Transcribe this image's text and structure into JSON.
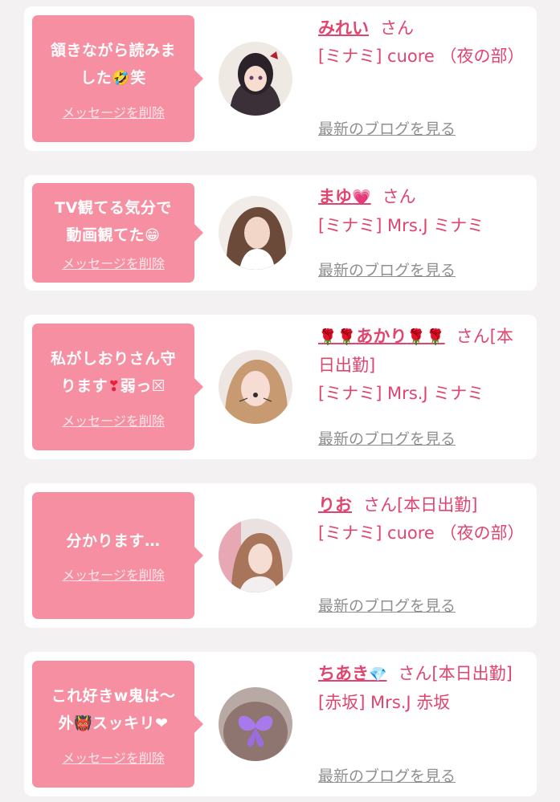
{
  "theme": {
    "bubble": "#f78fa2",
    "accent": "#e0456f",
    "muted": "#8f8f8f",
    "background": "#f3f1f2"
  },
  "cards": [
    {
      "message_line1": "頷きながら読みま",
      "message_line2_text": "した",
      "message_line2_emoji": "🤣",
      "message_line2_suffix": "笑",
      "delete_label": "メッセージを削除",
      "name": "みれい",
      "honorific": "さん",
      "shop": "[ミナミ] cuore （夜の部）",
      "blog_label": "最新のブログを見る"
    },
    {
      "message_line1": "TV観てる気分で",
      "message_line2_text": "動画観てた",
      "message_line2_emoji": "😁",
      "delete_label": "メッセージを削除",
      "name": "まゆ",
      "name_emoji": "💗",
      "honorific": "さん",
      "shop": "[ミナミ] Mrs.J ミナミ",
      "blog_label": "最新のブログを見る"
    },
    {
      "message_line1": "私がしおりさん守",
      "message_line2_text": "ります",
      "message_line2_emoji": "❣",
      "message_line2_suffix": "弱っ☒",
      "delete_label": "メッセージを削除",
      "name_prefix": "🌹🌹",
      "name": "あかり",
      "name_suffix": "🌹🌹",
      "honorific": "さん[本日出勤]",
      "shop": "[ミナミ] Mrs.J ミナミ",
      "blog_label": "最新のブログを見る"
    },
    {
      "message_line1": "分かります…",
      "delete_label": "メッセージを削除",
      "name": "りお",
      "honorific": "さん[本日出勤]",
      "shop": "[ミナミ] cuore （夜の部）",
      "blog_label": "最新のブログを見る"
    },
    {
      "message_line1": "これ好きw鬼は〜",
      "message_line2_text": "外",
      "message_line2_emoji": "👹",
      "message_line2_suffix": "スッキリ❤",
      "delete_label": "メッセージを削除",
      "name": "ちあき",
      "name_emoji": "💎",
      "honorific": "さん[本日出勤]",
      "shop": "[赤坂] Mrs.J 赤坂",
      "blog_label": "最新のブログを見る"
    }
  ]
}
